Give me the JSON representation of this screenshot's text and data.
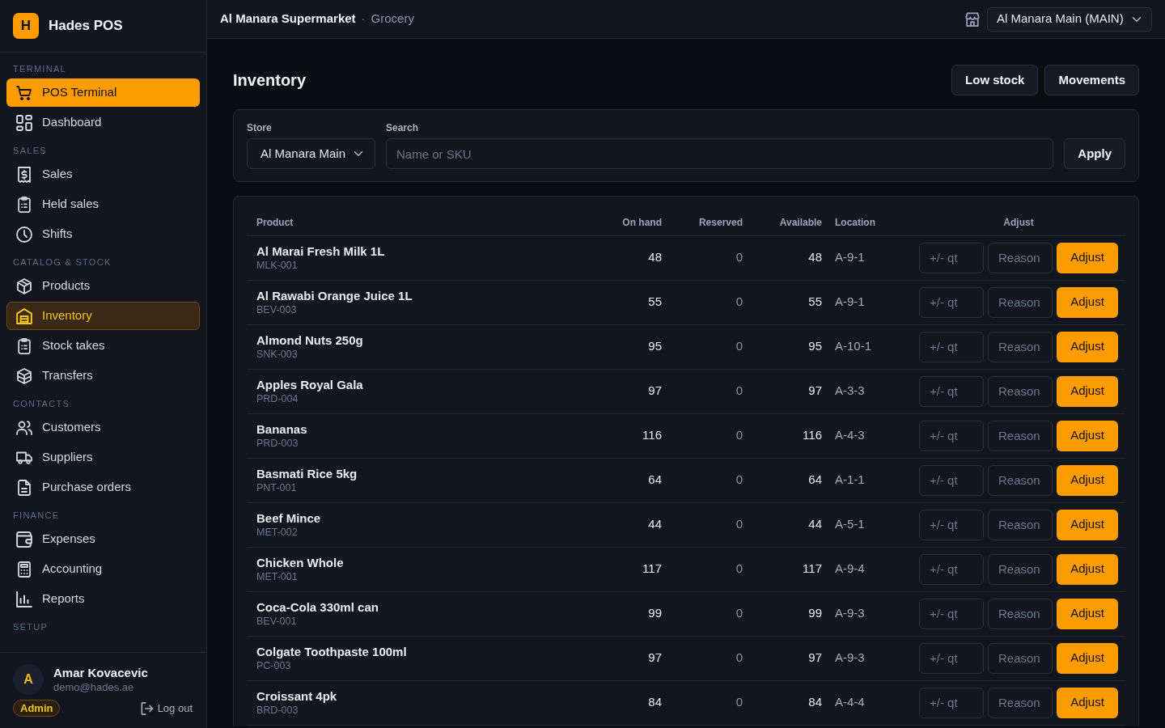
{
  "brand": {
    "mark": "H",
    "name": "Hades POS"
  },
  "sidebar": {
    "sections": [
      {
        "label": "TERMINAL",
        "items": [
          {
            "kind": "primary",
            "label": "POS Terminal",
            "selected": false
          },
          {
            "kind": "link",
            "label": "Dashboard",
            "selected": false
          }
        ]
      },
      {
        "label": "SALES",
        "items": [
          {
            "kind": "link",
            "label": "Sales",
            "selected": false
          },
          {
            "kind": "link",
            "label": "Held sales",
            "selected": false
          },
          {
            "kind": "link",
            "label": "Shifts",
            "selected": false
          }
        ]
      },
      {
        "label": "CATALOG & STOCK",
        "items": [
          {
            "kind": "link",
            "label": "Products",
            "selected": false
          },
          {
            "kind": "link",
            "label": "Inventory",
            "selected": true
          },
          {
            "kind": "link",
            "label": "Stock takes",
            "selected": false
          },
          {
            "kind": "link",
            "label": "Transfers",
            "selected": false
          }
        ]
      },
      {
        "label": "CONTACTS",
        "items": [
          {
            "kind": "link",
            "label": "Customers",
            "selected": false
          },
          {
            "kind": "link",
            "label": "Suppliers",
            "selected": false
          },
          {
            "kind": "link",
            "label": "Purchase orders",
            "selected": false
          }
        ]
      },
      {
        "label": "FINANCE",
        "items": [
          {
            "kind": "link",
            "label": "Expenses",
            "selected": false
          },
          {
            "kind": "link",
            "label": "Accounting",
            "selected": false
          },
          {
            "kind": "link",
            "label": "Reports",
            "selected": false
          }
        ]
      },
      {
        "label": "SETUP"
      }
    ]
  },
  "user": {
    "initial": "A",
    "name": "Amar Kovacevic",
    "email": "demo@hades.ae",
    "role": "Admin",
    "logout": "Log out"
  },
  "header": {
    "business": "Al Manara Supermarket",
    "separator": "·",
    "category": "Grocery",
    "store_select": "Al Manara Main (MAIN)"
  },
  "page": {
    "title": "Inventory",
    "actions": [
      "Low stock",
      "Movements"
    ]
  },
  "filters": {
    "store": {
      "label": "Store",
      "value": "Al Manara Main"
    },
    "search": {
      "label": "Search",
      "placeholder": "Name or SKU"
    },
    "apply": "Apply"
  },
  "table": {
    "columns": [
      "Product",
      "On hand",
      "Reserved",
      "Available",
      "Location",
      "Adjust"
    ],
    "rows": [
      {
        "product": "Al Marai Fresh Milk 1L",
        "sku": "MLK-001",
        "on_hand": "48",
        "reserved": "0",
        "available": "48",
        "location": "A-9-1",
        "qty_placeholder": "+/- qt",
        "reason_placeholder": "Reason",
        "action": "Adjust"
      },
      {
        "product": "Al Rawabi Orange Juice 1L",
        "sku": "BEV-003",
        "on_hand": "55",
        "reserved": "0",
        "available": "55",
        "location": "A-9-1",
        "qty_placeholder": "+/- qt",
        "reason_placeholder": "Reason",
        "action": "Adjust"
      },
      {
        "product": "Almond Nuts 250g",
        "sku": "SNK-003",
        "on_hand": "95",
        "reserved": "0",
        "available": "95",
        "location": "A-10-1",
        "qty_placeholder": "+/- qt",
        "reason_placeholder": "Reason",
        "action": "Adjust"
      },
      {
        "product": "Apples Royal Gala",
        "sku": "PRD-004",
        "on_hand": "97",
        "reserved": "0",
        "available": "97",
        "location": "A-3-3",
        "qty_placeholder": "+/- qt",
        "reason_placeholder": "Reason",
        "action": "Adjust"
      },
      {
        "product": "Bananas",
        "sku": "PRD-003",
        "on_hand": "116",
        "reserved": "0",
        "available": "116",
        "location": "A-4-3",
        "qty_placeholder": "+/- qt",
        "reason_placeholder": "Reason",
        "action": "Adjust"
      },
      {
        "product": "Basmati Rice 5kg",
        "sku": "PNT-001",
        "on_hand": "64",
        "reserved": "0",
        "available": "64",
        "location": "A-1-1",
        "qty_placeholder": "+/- qt",
        "reason_placeholder": "Reason",
        "action": "Adjust"
      },
      {
        "product": "Beef Mince",
        "sku": "MET-002",
        "on_hand": "44",
        "reserved": "0",
        "available": "44",
        "location": "A-5-1",
        "qty_placeholder": "+/- qt",
        "reason_placeholder": "Reason",
        "action": "Adjust"
      },
      {
        "product": "Chicken Whole",
        "sku": "MET-001",
        "on_hand": "117",
        "reserved": "0",
        "available": "117",
        "location": "A-9-4",
        "qty_placeholder": "+/- qt",
        "reason_placeholder": "Reason",
        "action": "Adjust"
      },
      {
        "product": "Coca-Cola 330ml can",
        "sku": "BEV-001",
        "on_hand": "99",
        "reserved": "0",
        "available": "99",
        "location": "A-9-3",
        "qty_placeholder": "+/- qt",
        "reason_placeholder": "Reason",
        "action": "Adjust"
      },
      {
        "product": "Colgate Toothpaste 100ml",
        "sku": "PC-003",
        "on_hand": "97",
        "reserved": "0",
        "available": "97",
        "location": "A-9-3",
        "qty_placeholder": "+/- qt",
        "reason_placeholder": "Reason",
        "action": "Adjust"
      },
      {
        "product": "Croissant 4pk",
        "sku": "BRD-003",
        "on_hand": "84",
        "reserved": "0",
        "available": "84",
        "location": "A-4-4",
        "qty_placeholder": "+/- qt",
        "reason_placeholder": "Reason",
        "action": "Adjust"
      }
    ]
  }
}
